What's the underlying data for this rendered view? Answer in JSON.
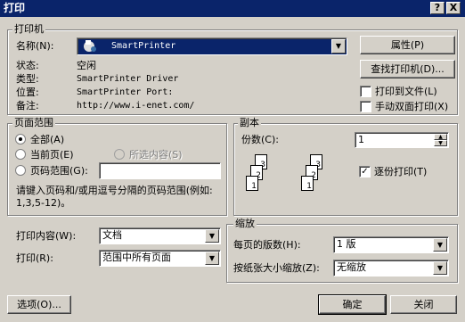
{
  "window": {
    "title": "打印",
    "help_btn": "?",
    "close_btn": "X"
  },
  "printer": {
    "group_label": "打印机",
    "name_label": "名称(N):",
    "name_value": "SmartPrinter",
    "status_label": "状态:",
    "status_value": "空闲",
    "type_label": "类型:",
    "type_value": "SmartPrinter Driver",
    "location_label": "位置:",
    "location_value": "SmartPrinter Port:",
    "comment_label": "备注:",
    "comment_value": "http://www.i-enet.com/",
    "properties_btn": "属性(P)",
    "find_btn": "查找打印机(D)...",
    "print_to_file": "打印到文件(L)",
    "manual_duplex": "手动双面打印(X)"
  },
  "range": {
    "group_label": "页面范围",
    "all": "全部(A)",
    "current": "当前页(E)",
    "selection": "所选内容(S)",
    "pages": "页码范围(G):",
    "pages_value": "",
    "hint": "请键入页码和/或用逗号分隔的页码范围(例如: 1,3,5-12)。"
  },
  "copies": {
    "group_label": "副本",
    "count_label": "份数(C):",
    "count_value": "1",
    "collate": "逐份打印(T)",
    "collate_checked": true,
    "page_nums": [
      "1",
      "2",
      "3",
      "1",
      "2",
      "3"
    ]
  },
  "print_what": {
    "label": "打印内容(W):",
    "value": "文档"
  },
  "print": {
    "label": "打印(R):",
    "value": "范围中所有页面"
  },
  "zoom": {
    "group_label": "缩放",
    "per_sheet_label": "每页的版数(H):",
    "per_sheet_value": "1 版",
    "scale_label": "按纸张大小缩放(Z):",
    "scale_value": "无缩放"
  },
  "footer": {
    "options_btn": "选项(O)...",
    "ok_btn": "确定",
    "close_btn": "关闭"
  }
}
